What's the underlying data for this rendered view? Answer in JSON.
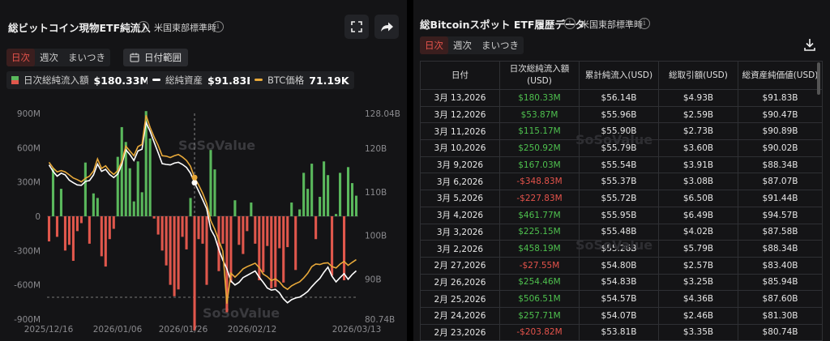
{
  "left_panel": {
    "title": "総ビットコイン現物ETF純流入",
    "timezone": "米国東部標準時",
    "tabs": [
      {
        "label": "日次",
        "active": true
      },
      {
        "label": "週次",
        "active": false
      },
      {
        "label": "まいつき",
        "active": false
      }
    ],
    "date_range_label": "日付範囲",
    "legend": {
      "inflow_label": "日次総純流入額",
      "inflow_value": "$180.33M",
      "assets_label": "総純資産",
      "assets_value": "$91.83B",
      "price_label": "BTC価格",
      "price_value": "71.19K"
    },
    "watermark": "SoSoValue"
  },
  "chart_data": {
    "type": "bar",
    "left_axis_ticks": [
      "900M",
      "600M",
      "300M",
      "0",
      "-300M",
      "-600M",
      "-900M"
    ],
    "right_axis_ticks": [
      "128.04B",
      "120B",
      "110B",
      "100B",
      "90B",
      "80.74B"
    ],
    "x_tick_labels": [
      "2025/12/16",
      "2026/01/06",
      "2026/01/26",
      "2026/02/12",
      "2026/03/13"
    ],
    "ylim_left": [
      -900,
      900
    ],
    "ylim_right": [
      80.74,
      128.04
    ],
    "bar_colors": {
      "positive": "#5ab85c",
      "negative": "#e0574c"
    },
    "daily_inflow": [
      -220,
      420,
      -180,
      240,
      -300,
      -250,
      -390,
      -130,
      -60,
      470,
      -240,
      200,
      160,
      -350,
      -440,
      -200,
      -110,
      520,
      780,
      650,
      420,
      130,
      480,
      210,
      920,
      680,
      -20,
      -160,
      -300,
      -430,
      -600,
      -700,
      -640,
      -180,
      -290,
      160,
      -1000,
      -200,
      -240,
      -600,
      580,
      410,
      -480,
      -240,
      -840,
      -580,
      140,
      -250,
      -330,
      -130,
      120,
      -240,
      -560,
      -490,
      -260,
      -630,
      -620,
      -280,
      -580,
      -270,
      120,
      -470,
      60,
      380,
      240,
      460,
      -200,
      170,
      480,
      360,
      -520,
      20,
      380,
      -560,
      430,
      290,
      180
    ],
    "total_assets_B": [
      116.2,
      114.7,
      113.6,
      114.3,
      113.9,
      112.7,
      112.1,
      111.6,
      111.5,
      112.4,
      112.6,
      113.9,
      116.4,
      114.7,
      115.2,
      114.0,
      113.3,
      114.1,
      116.3,
      119.7,
      118.6,
      117.2,
      119.4,
      119.8,
      126.0,
      123.9,
      121.4,
      119.0,
      116.5,
      116.3,
      116.2,
      116.6,
      116.8,
      116.3,
      115.6,
      114.3,
      112.1,
      110.2,
      108.2,
      106.1,
      101.4,
      99.7,
      96.8,
      94.3,
      92.3,
      89.5,
      88.6,
      89.2,
      90.3,
      90.8,
      91.3,
      91.8,
      90.4,
      89.2,
      87.9,
      87.4,
      87.6,
      86.8,
      85.4,
      84.5,
      85.2,
      85.6,
      85.8,
      86.4,
      87.1,
      88.2,
      89.2,
      90.1,
      91.5,
      92.7,
      90.6,
      89.3,
      90.3,
      91.2,
      89.9,
      91.0,
      91.83
    ],
    "btc_price_B_scale": [
      116.8,
      115.5,
      114.6,
      114.9,
      114.6,
      113.9,
      113.2,
      112.8,
      112.3,
      113.1,
      113.6,
      114.8,
      117.6,
      115.4,
      116.0,
      114.8,
      114.0,
      114.9,
      117.0,
      120.5,
      119.4,
      118.3,
      120.4,
      120.9,
      127.6,
      124.8,
      122.6,
      120.7,
      118.3,
      118.2,
      117.9,
      118.3,
      118.6,
      118.0,
      117.2,
      115.9,
      113.3,
      111.6,
      109.7,
      107.3,
      103.4,
      101.4,
      98.9,
      96.4,
      84.3,
      91.3,
      90.4,
      91.3,
      92.3,
      92.8,
      93.2,
      93.6,
      92.6,
      91.1,
      90.5,
      89.6,
      90.0,
      89.3,
      88.2,
      87.6,
      88.4,
      88.9,
      89.3,
      90.2,
      91.3,
      92.8,
      93.4,
      93.3,
      93.6,
      93.7,
      92.8,
      92.5,
      93.4,
      94.0,
      93.1,
      93.8,
      94.4
    ],
    "highlight_index": 36
  },
  "right_panel": {
    "title": "総Bitcoinスポット ETF履歴データ",
    "timezone": "米国東部標準時",
    "tabs": [
      {
        "label": "日次",
        "active": true
      },
      {
        "label": "週次",
        "active": false
      },
      {
        "label": "まいつき",
        "active": false
      }
    ],
    "table": {
      "headers": [
        "日付",
        "日次総純流入額\n(USD)",
        "累計純流入(USD)",
        "総取引額(USD)",
        "総資産純価値(USD)"
      ],
      "rows": [
        [
          "3月 13,2026",
          "$180.33M",
          "$56.14B",
          "$4.93B",
          "$91.83B"
        ],
        [
          "3月 12,2026",
          "$53.87M",
          "$55.96B",
          "$2.59B",
          "$90.47B"
        ],
        [
          "3月 11,2026",
          "$115.17M",
          "$55.90B",
          "$2.73B",
          "$90.89B"
        ],
        [
          "3月 10,2026",
          "$250.92M",
          "$55.79B",
          "$3.60B",
          "$90.02B"
        ],
        [
          "3月 9,2026",
          "$167.03M",
          "$55.54B",
          "$3.91B",
          "$88.34B"
        ],
        [
          "3月 6,2026",
          "-$348.83M",
          "$55.37B",
          "$3.08B",
          "$87.07B"
        ],
        [
          "3月 5,2026",
          "-$227.83M",
          "$55.72B",
          "$6.50B",
          "$91.44B"
        ],
        [
          "3月 4,2026",
          "$461.77M",
          "$55.95B",
          "$6.49B",
          "$94.57B"
        ],
        [
          "3月 3,2026",
          "$225.15M",
          "$55.48B",
          "$4.02B",
          "$87.58B"
        ],
        [
          "3月 2,2026",
          "$458.19M",
          "$55.26B",
          "$5.79B",
          "$88.34B"
        ],
        [
          "2月 27,2026",
          "-$27.55M",
          "$54.80B",
          "$2.57B",
          "$83.40B"
        ],
        [
          "2月 26,2026",
          "$254.46M",
          "$54.83B",
          "$3.25B",
          "$85.94B"
        ],
        [
          "2月 25,2026",
          "$506.51M",
          "$54.57B",
          "$4.36B",
          "$87.60B"
        ],
        [
          "2月 24,2026",
          "$257.71M",
          "$54.07B",
          "$2.46B",
          "$81.30B"
        ],
        [
          "2月 23,2026",
          "-$203.82M",
          "$53.81B",
          "$3.35B",
          "$80.74B"
        ]
      ]
    },
    "watermark": "SoSoValue"
  },
  "icons": {
    "info": "info-icon",
    "fullscreen": "fullscreen-icon",
    "share": "share-icon",
    "download": "download-icon",
    "calendar": "calendar-icon"
  },
  "colors": {
    "positive": "#5ab85c",
    "negative": "#e0574c",
    "assets_line": "#ffffff",
    "price_line": "#e8a93a",
    "active_tab": "#e5534b"
  }
}
